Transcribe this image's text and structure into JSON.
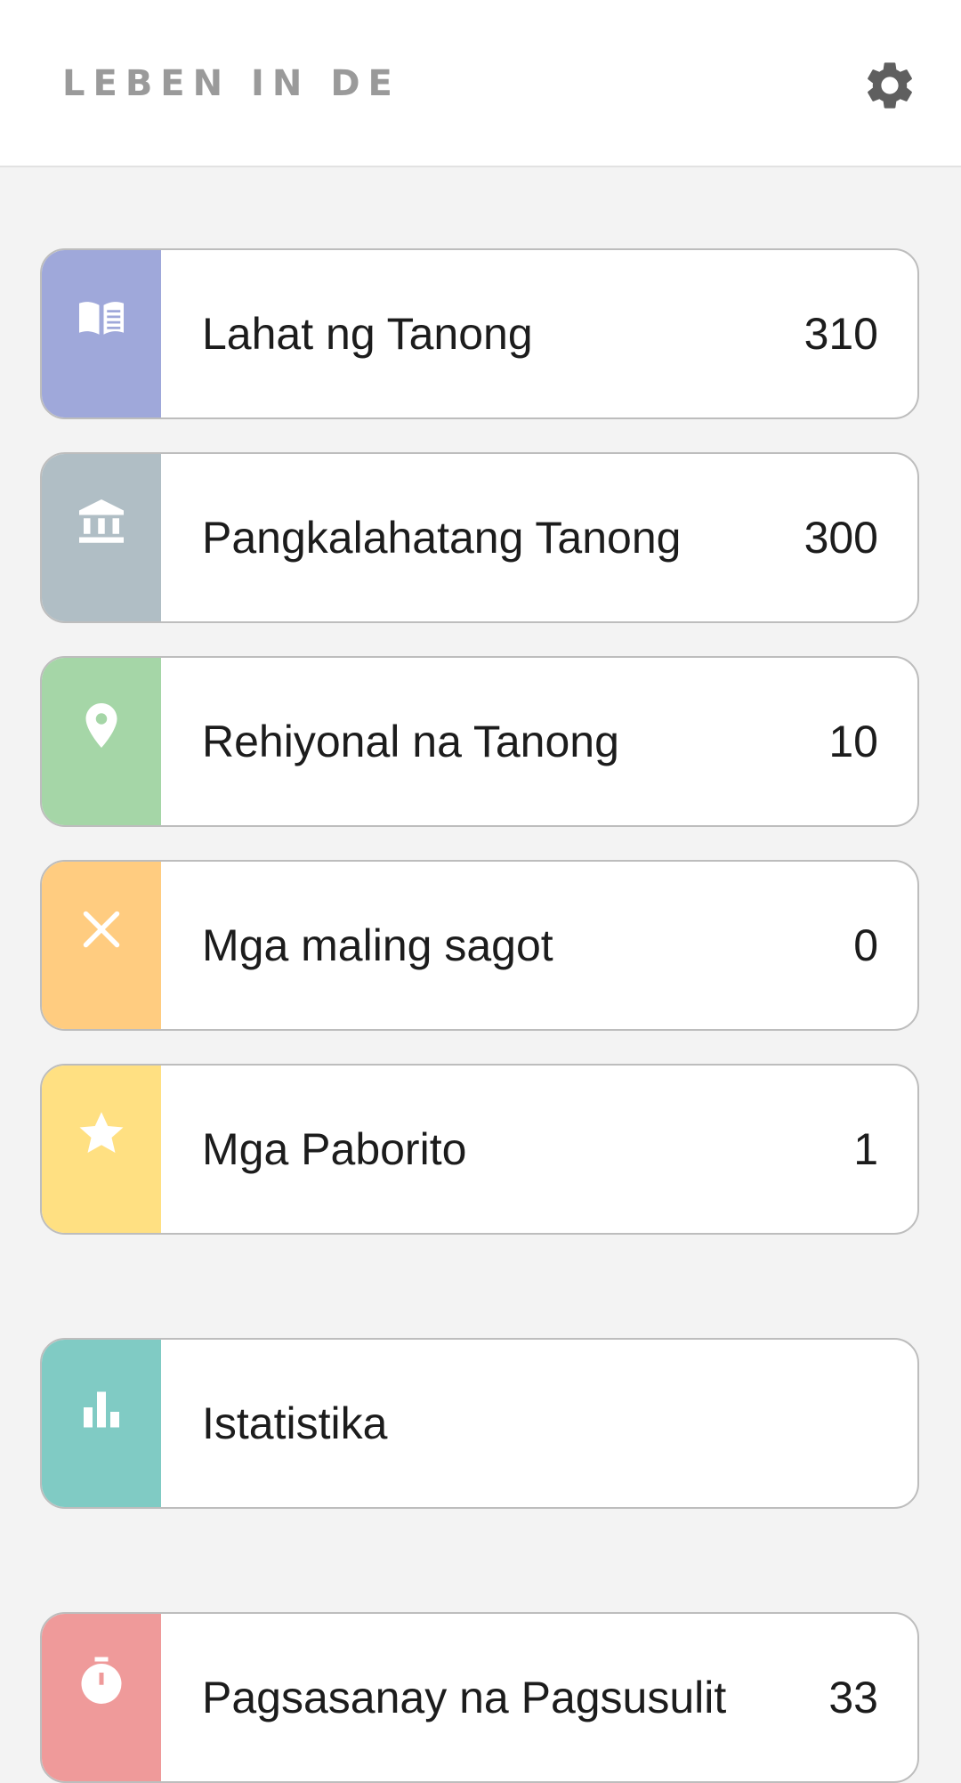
{
  "header": {
    "title": "LEBEN IN DE",
    "settings_icon": "gear-icon"
  },
  "menu": [
    {
      "label": "Lahat ng Tanong",
      "count": "310",
      "color": "#9fa8da",
      "icon": "book-icon"
    },
    {
      "label": "Pangkalahatang Tanong",
      "count": "300",
      "color": "#b0bec5",
      "icon": "bank-icon"
    },
    {
      "label": "Rehiyonal na Tanong",
      "count": "10",
      "color": "#a5d6a7",
      "icon": "location-pin-icon"
    },
    {
      "label": "Mga maling sagot",
      "count": "0",
      "color": "#ffcc80",
      "icon": "close-icon"
    },
    {
      "label": "Mga Paborito",
      "count": "1",
      "color": "#ffe082",
      "icon": "star-icon"
    }
  ],
  "stats": {
    "label": "Istatistika",
    "color": "#80cbc4",
    "icon": "bar-chart-icon"
  },
  "practice": {
    "label": "Pagsasanay na Pagsusulit",
    "count": "33",
    "color": "#ef9a9a",
    "icon": "stopwatch-icon"
  }
}
